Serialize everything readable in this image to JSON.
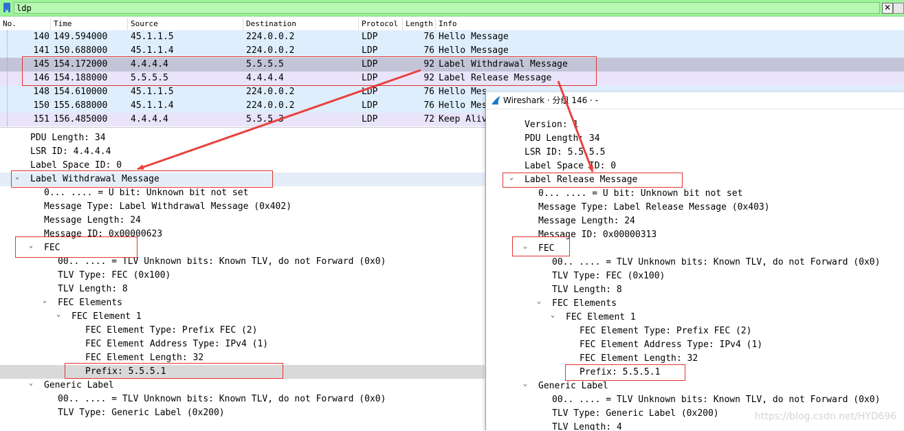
{
  "filter": {
    "value": "ldp",
    "clear_icon": "✕"
  },
  "columns": [
    "No.",
    "Time",
    "Source",
    "Destination",
    "Protocol",
    "Length",
    "Info"
  ],
  "packets": [
    {
      "no": "140",
      "time": "149.594000",
      "src": "45.1.1.5",
      "dst": "224.0.0.2",
      "proto": "LDP",
      "len": "76",
      "info": "Hello Message"
    },
    {
      "no": "141",
      "time": "150.688000",
      "src": "45.1.1.4",
      "dst": "224.0.0.2",
      "proto": "LDP",
      "len": "76",
      "info": "Hello Message"
    },
    {
      "no": "145",
      "time": "154.172000",
      "src": "4.4.4.4",
      "dst": "5.5.5.5",
      "proto": "LDP",
      "len": "92",
      "info": "Label Withdrawal Message"
    },
    {
      "no": "146",
      "time": "154.188000",
      "src": "5.5.5.5",
      "dst": "4.4.4.4",
      "proto": "LDP",
      "len": "92",
      "info": "Label Release Message"
    },
    {
      "no": "148",
      "time": "154.610000",
      "src": "45.1.1.5",
      "dst": "224.0.0.2",
      "proto": "LDP",
      "len": "76",
      "info": "Hello Mes"
    },
    {
      "no": "150",
      "time": "155.688000",
      "src": "45.1.1.4",
      "dst": "224.0.0.2",
      "proto": "LDP",
      "len": "76",
      "info": "Hello Mes"
    },
    {
      "no": "151",
      "time": "156.485000",
      "src": "4.4.4.4",
      "dst": "5.5.5.3",
      "proto": "LDP",
      "len": "72",
      "info": "Keep Aliv"
    }
  ],
  "detail": [
    {
      "text": "PDU Length: 34"
    },
    {
      "text": "LSR ID: 4.4.4.4"
    },
    {
      "text": "Label Space ID: 0"
    },
    {
      "text": "Label Withdrawal Message"
    },
    {
      "text": "0... .... = U bit: Unknown bit not set"
    },
    {
      "text": "Message Type: Label Withdrawal Message (0x402)"
    },
    {
      "text": "Message Length: 24"
    },
    {
      "text": "Message ID: 0x00000623"
    },
    {
      "text": "FEC"
    },
    {
      "text": "00.. .... = TLV Unknown bits: Known TLV, do not Forward (0x0)"
    },
    {
      "text": "TLV Type: FEC (0x100)"
    },
    {
      "text": "TLV Length: 8"
    },
    {
      "text": "FEC Elements"
    },
    {
      "text": "FEC Element 1"
    },
    {
      "text": "FEC Element Type: Prefix FEC (2)"
    },
    {
      "text": "FEC Element Address Type: IPv4 (1)"
    },
    {
      "text": "FEC Element Length: 32"
    },
    {
      "text": "Prefix: 5.5.5.1"
    },
    {
      "text": "Generic Label"
    },
    {
      "text": "00.. .... = TLV Unknown bits: Known TLV, do not Forward (0x0)"
    },
    {
      "text": "TLV Type: Generic Label (0x200)"
    }
  ],
  "popup": {
    "title": "Wireshark · 分组 146 · -",
    "lines": [
      {
        "text": "Version: 1"
      },
      {
        "text": "PDU Length: 34"
      },
      {
        "text": "LSR ID: 5.5.5.5"
      },
      {
        "text": "Label Space ID: 0"
      },
      {
        "text": "Label Release Message"
      },
      {
        "text": "0... .... = U bit: Unknown bit not set"
      },
      {
        "text": "Message Type: Label Release Message (0x403)"
      },
      {
        "text": "Message Length: 24"
      },
      {
        "text": "Message ID: 0x00000313"
      },
      {
        "text": "FEC"
      },
      {
        "text": "00.. .... = TLV Unknown bits: Known TLV, do not Forward (0x0)"
      },
      {
        "text": "TLV Type: FEC (0x100)"
      },
      {
        "text": "TLV Length: 8"
      },
      {
        "text": "FEC Elements"
      },
      {
        "text": "FEC Element 1"
      },
      {
        "text": "FEC Element Type: Prefix FEC (2)"
      },
      {
        "text": "FEC Element Address Type: IPv4 (1)"
      },
      {
        "text": "FEC Element Length: 32"
      },
      {
        "text": "Prefix: 5.5.5.1"
      },
      {
        "text": "Generic Label"
      },
      {
        "text": "00.. .... = TLV Unknown bits: Known TLV, do not Forward (0x0)"
      },
      {
        "text": "TLV Type: Generic Label (0x200)"
      },
      {
        "text": "TLV Length: 4"
      }
    ]
  },
  "watermark": "https://blog.csdn.net/HYD696",
  "colors": {
    "filter_bg": "#9ef49a",
    "row_blue": "#dfeefc",
    "row_lavender": "#e9e4fa",
    "row_selected": "#c4c4d8",
    "annotation": "#e0322e"
  }
}
